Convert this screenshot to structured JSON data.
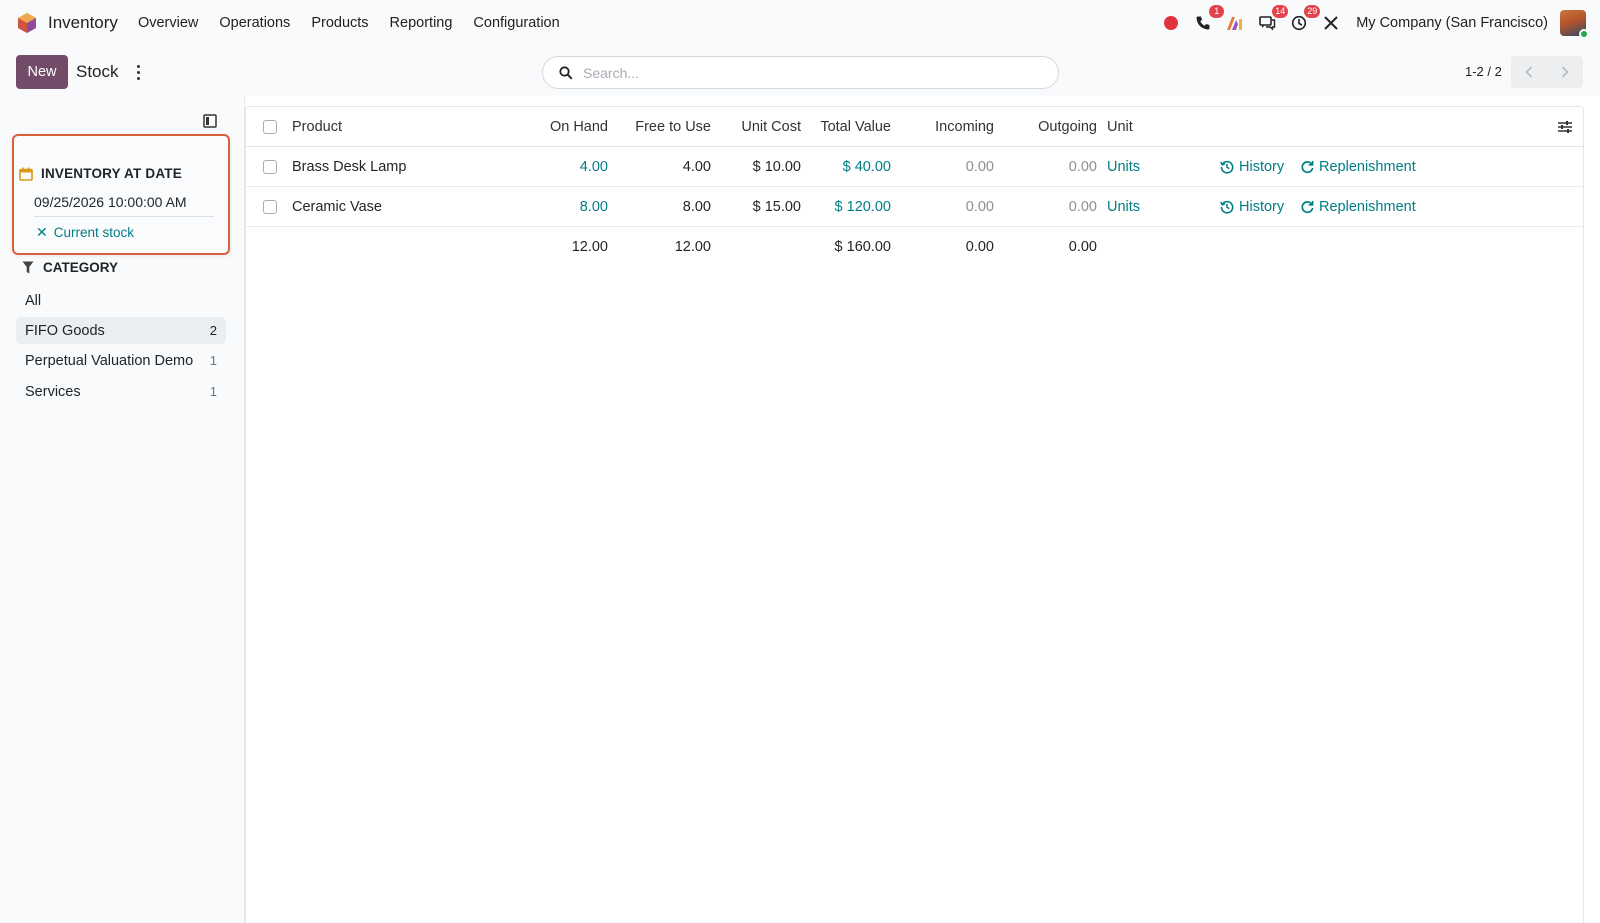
{
  "navbar": {
    "app_name": "Inventory",
    "menu": [
      "Overview",
      "Operations",
      "Products",
      "Reporting",
      "Configuration"
    ],
    "badges": {
      "phone": "1",
      "messages": "14",
      "activities": "29"
    },
    "company": "My Company (San Francisco)"
  },
  "control": {
    "new_label": "New",
    "breadcrumb": "Stock",
    "search_placeholder": "Search...",
    "pager": "1-2 / 2"
  },
  "sidebar": {
    "date_panel": {
      "title": "INVENTORY AT DATE",
      "value": "09/25/2026 10:00:00 AM",
      "reset_label": "Current stock"
    },
    "category": {
      "title": "CATEGORY",
      "items": [
        {
          "label": "All",
          "count": ""
        },
        {
          "label": "FIFO Goods",
          "count": "2"
        },
        {
          "label": "Perpetual Valuation Demo",
          "count": "1"
        },
        {
          "label": "Services",
          "count": "1"
        }
      ]
    }
  },
  "table": {
    "columns": [
      "Product",
      "On Hand",
      "Free to Use",
      "Unit Cost",
      "Total Value",
      "Incoming",
      "Outgoing",
      "Unit"
    ],
    "rows": [
      {
        "product": "Brass Desk Lamp",
        "on_hand": "4.00",
        "free": "4.00",
        "unit_cost": "$ 10.00",
        "total": "$ 40.00",
        "incoming": "0.00",
        "outgoing": "0.00",
        "unit": "Units",
        "history": "History",
        "replenishment": "Replenishment"
      },
      {
        "product": "Ceramic Vase",
        "on_hand": "8.00",
        "free": "8.00",
        "unit_cost": "$ 15.00",
        "total": "$ 120.00",
        "incoming": "0.00",
        "outgoing": "0.00",
        "unit": "Units",
        "history": "History",
        "replenishment": "Replenishment"
      }
    ],
    "totals": {
      "on_hand": "12.00",
      "free": "12.00",
      "total": "$ 160.00",
      "incoming": "0.00",
      "outgoing": "0.00"
    }
  },
  "colors": {
    "brand": "#714b67",
    "link": "#017e84",
    "highlight": "#d9603a",
    "badge": "#e3434c"
  }
}
